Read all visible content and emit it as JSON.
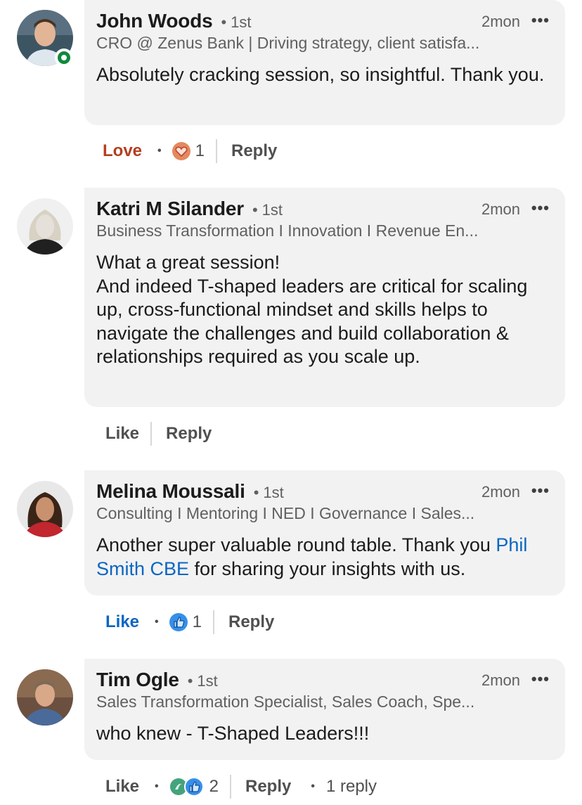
{
  "comments": [
    {
      "name": "John Woods",
      "degree": "1st",
      "time": "2mon",
      "headline": "CRO @ Zenus Bank | Driving strategy, client satisfa...",
      "body": "Absolutely cracking session, so insightful. Thank you.",
      "reaction_label": "Love",
      "reaction_count": "1",
      "reply_label": "Reply",
      "online": true
    },
    {
      "name": "Katri M Silander",
      "degree": "1st",
      "time": "2mon",
      "headline": "Business Transformation I Innovation I Revenue En...",
      "body_lines": [
        "What a great session!",
        "And indeed T-shaped leaders are critical for scaling up, cross-functional mindset and skills helps to navigate the challenges and build collaboration & relationships required as you scale up."
      ],
      "reaction_label": "Like",
      "reply_label": "Reply"
    },
    {
      "name": "Melina Moussali",
      "degree": "1st",
      "time": "2mon",
      "headline": "Consulting I Mentoring I NED I Governance I Sales...",
      "body_pre": "Another super valuable round table. Thank you ",
      "mention": "Phil Smith CBE",
      "body_post": " for sharing your insights with us.",
      "reaction_label": "Like",
      "reaction_count": "1",
      "reply_label": "Reply"
    },
    {
      "name": "Tim Ogle",
      "degree": "1st",
      "time": "2mon",
      "headline": "Sales Transformation Specialist, Sales Coach, Spe...",
      "body": "who knew - T-Shaped Leaders!!!",
      "reaction_label": "Like",
      "reaction_count": "2",
      "reply_label": "Reply",
      "replies_text": "1 reply"
    }
  ],
  "colors": {
    "love": "#b24020",
    "like_active": "#0a66c2",
    "online": "#0f8a3c",
    "bubble_bg": "#f2f2f2"
  },
  "icons": [
    "more-icon",
    "love-reaction-icon",
    "like-reaction-icon",
    "celebrate-reaction-icon",
    "online-status-icon"
  ]
}
